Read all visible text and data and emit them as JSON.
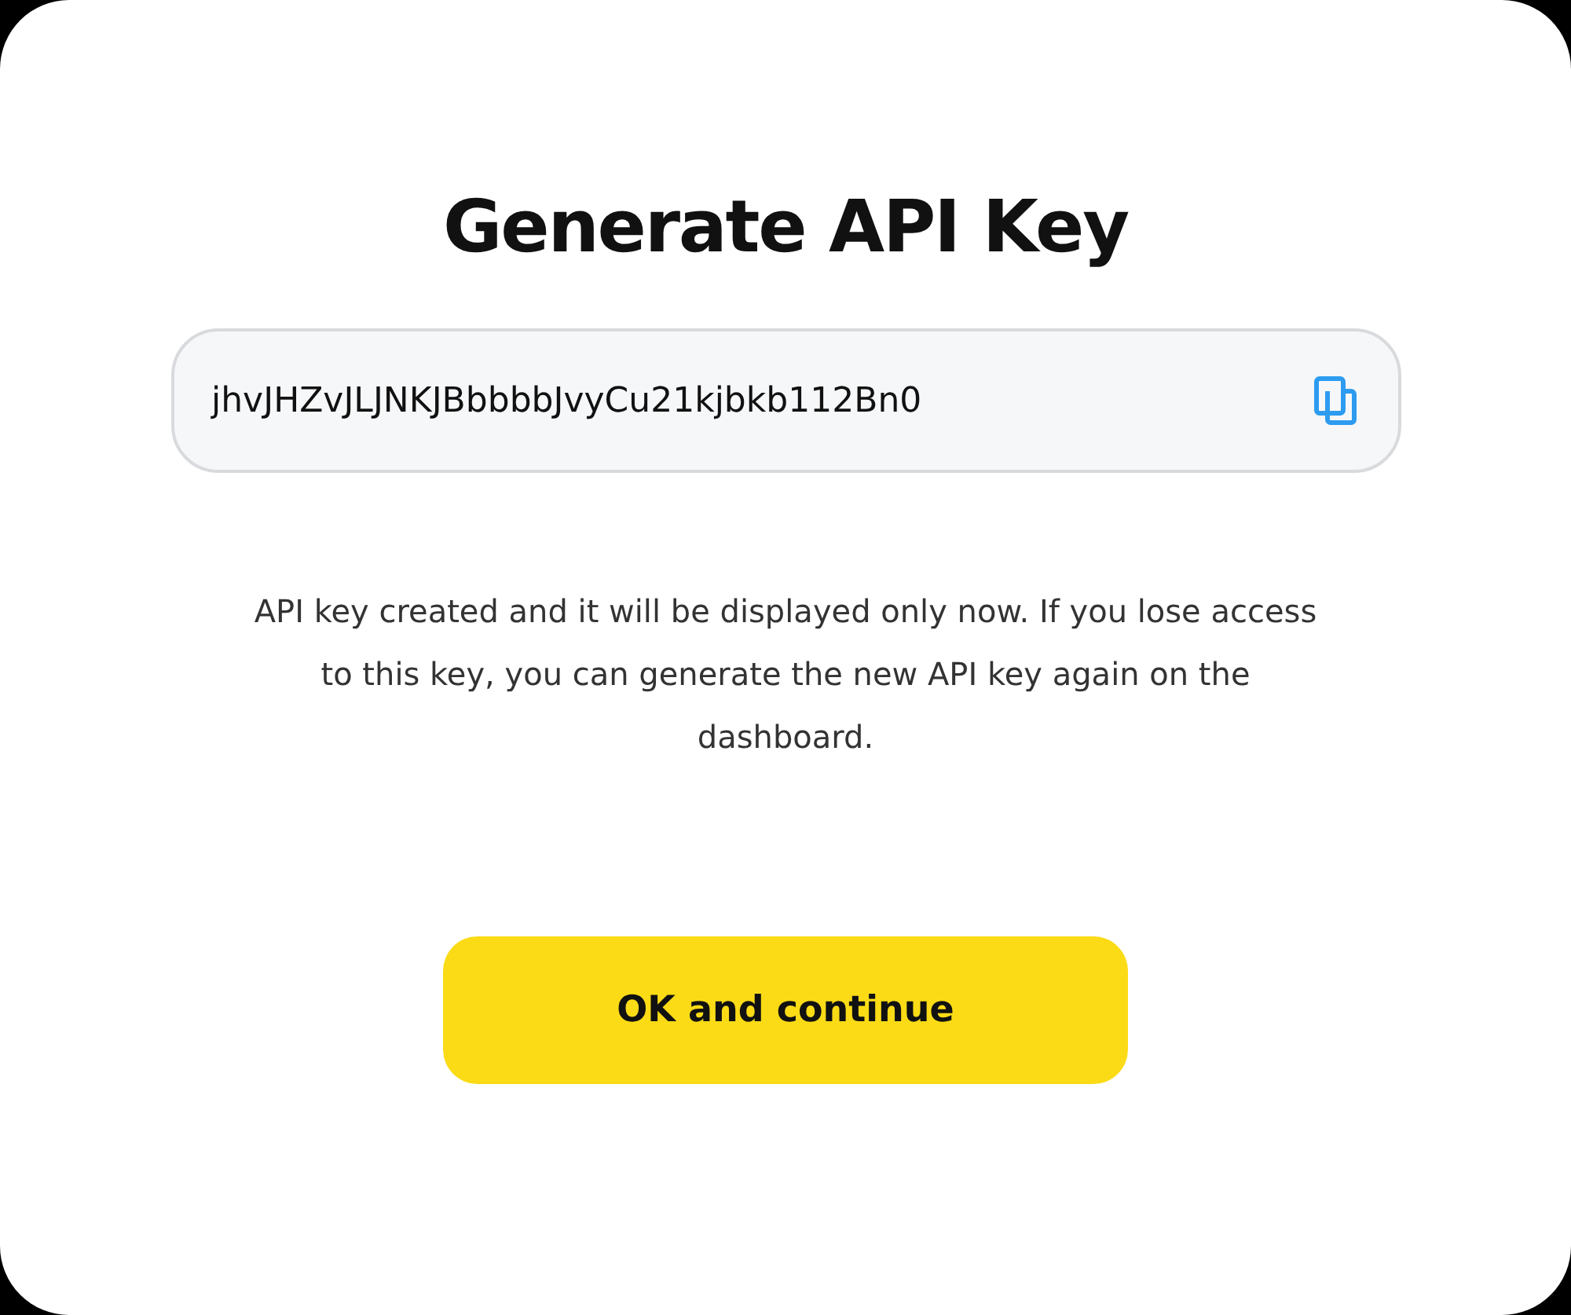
{
  "dialog": {
    "title": "Generate API Key",
    "api_key_field": {
      "value": "jhvJHZvJLJNKJBbbbbJvyCu21kjbkb112Bn0"
    },
    "message": "API key created and it will be displayed only now. If you lose access to this key, you can generate the new API key again on the dashboard.",
    "buttons": [
      "OK and continue"
    ]
  }
}
